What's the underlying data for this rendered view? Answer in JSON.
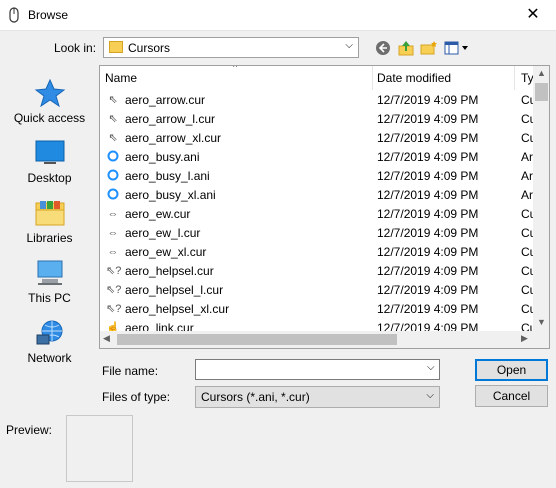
{
  "window": {
    "title": "Browse",
    "close_glyph": "✕"
  },
  "lookin": {
    "label": "Look in:",
    "value": "Cursors",
    "icon": "folder-icon"
  },
  "toolbar": {
    "icons": [
      "back-icon",
      "up-folder-icon",
      "new-folder-icon",
      "view-menu-icon"
    ]
  },
  "places": [
    {
      "label": "Quick access",
      "icon": "star-icon"
    },
    {
      "label": "Desktop",
      "icon": "desktop-icon"
    },
    {
      "label": "Libraries",
      "icon": "libraries-icon"
    },
    {
      "label": "This PC",
      "icon": "computer-icon"
    },
    {
      "label": "Network",
      "icon": "network-icon"
    }
  ],
  "filelist": {
    "columns": [
      "Name",
      "Date modified",
      "Ty"
    ],
    "rows": [
      {
        "name": "aero_arrow.cur",
        "date": "12/7/2019 4:09 PM",
        "type": "Cu",
        "icon": "arrow-cursor-icon"
      },
      {
        "name": "aero_arrow_l.cur",
        "date": "12/7/2019 4:09 PM",
        "type": "Cu",
        "icon": "arrow-cursor-icon"
      },
      {
        "name": "aero_arrow_xl.cur",
        "date": "12/7/2019 4:09 PM",
        "type": "Cu",
        "icon": "arrow-cursor-icon"
      },
      {
        "name": "aero_busy.ani",
        "date": "12/7/2019 4:09 PM",
        "type": "Ar",
        "icon": "busy-ring-icon"
      },
      {
        "name": "aero_busy_l.ani",
        "date": "12/7/2019 4:09 PM",
        "type": "Ar",
        "icon": "busy-ring-icon"
      },
      {
        "name": "aero_busy_xl.ani",
        "date": "12/7/2019 4:09 PM",
        "type": "Ar",
        "icon": "busy-ring-icon"
      },
      {
        "name": "aero_ew.cur",
        "date": "12/7/2019 4:09 PM",
        "type": "Cu",
        "icon": "horizontal-resize-icon"
      },
      {
        "name": "aero_ew_l.cur",
        "date": "12/7/2019 4:09 PM",
        "type": "Cu",
        "icon": "horizontal-resize-icon"
      },
      {
        "name": "aero_ew_xl.cur",
        "date": "12/7/2019 4:09 PM",
        "type": "Cu",
        "icon": "horizontal-resize-icon"
      },
      {
        "name": "aero_helpsel.cur",
        "date": "12/7/2019 4:09 PM",
        "type": "Cu",
        "icon": "help-cursor-icon"
      },
      {
        "name": "aero_helpsel_l.cur",
        "date": "12/7/2019 4:09 PM",
        "type": "Cu",
        "icon": "help-cursor-icon"
      },
      {
        "name": "aero_helpsel_xl.cur",
        "date": "12/7/2019 4:09 PM",
        "type": "Cu",
        "icon": "help-cursor-icon"
      },
      {
        "name": "aero_link.cur",
        "date": "12/7/2019 4:09 PM",
        "type": "Cu",
        "icon": "hand-cursor-icon"
      }
    ]
  },
  "fields": {
    "filename_label": "File name:",
    "filename_value": "",
    "filetype_label": "Files of type:",
    "filetype_value": "Cursors (*.ani, *.cur)"
  },
  "buttons": {
    "open": "Open",
    "cancel": "Cancel"
  },
  "preview": {
    "label": "Preview:"
  },
  "colors": {
    "accent": "#0078d7",
    "folder": "#f6cf54",
    "busy": "#1e90ff"
  }
}
